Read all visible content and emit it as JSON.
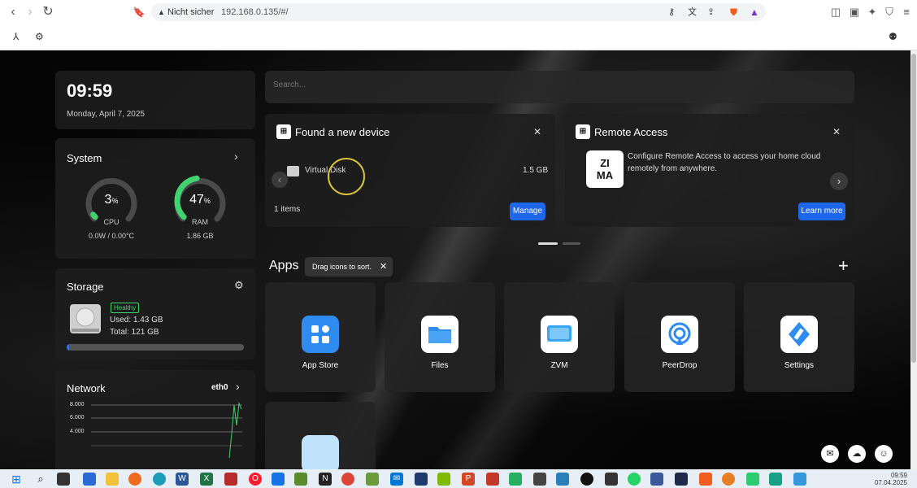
{
  "browser": {
    "security": "Nicht sicher",
    "url": "192.168.0.135/#/"
  },
  "widget_time": {
    "time": "09:59",
    "date": "Monday, April 7, 2025"
  },
  "system": {
    "title": "System",
    "cpu": {
      "value": "3",
      "unit": "%",
      "label": "CPU",
      "sub": "0.0W / 0.00°C",
      "fraction": 0.03
    },
    "ram": {
      "value": "47",
      "unit": "%",
      "label": "RAM",
      "sub": "1.86 GB",
      "fraction": 0.47
    }
  },
  "storage": {
    "title": "Storage",
    "status": "Healthy",
    "used": "Used: 1.43 GB",
    "total": "Total: 121 GB",
    "fraction": 0.012
  },
  "network": {
    "title": "Network",
    "iface": "eth0",
    "ticks": [
      "8.000",
      "6.000",
      "4.000"
    ]
  },
  "search": {
    "placeholder": "Search..."
  },
  "device": {
    "title": "Found a new device",
    "name": "Virtual Disk",
    "size": "1.5 GB",
    "count": "1 items",
    "button": "Manage"
  },
  "remote": {
    "title": "Remote Access",
    "logo": "ZI\nMA",
    "text": "Configure Remote Access to access your home cloud remotely from anywhere.",
    "button": "Learn more"
  },
  "apps": {
    "title": "Apps",
    "tip": "Drag icons to sort.",
    "items": [
      {
        "name": "App Store"
      },
      {
        "name": "Files"
      },
      {
        "name": "ZVM"
      },
      {
        "name": "PeerDrop"
      },
      {
        "name": "Settings"
      }
    ]
  },
  "taskbar": {
    "time": "09:59",
    "date": "07.04.2025"
  },
  "colors": {
    "accent": "#1e66ea",
    "gauge": "#3fd46f"
  }
}
